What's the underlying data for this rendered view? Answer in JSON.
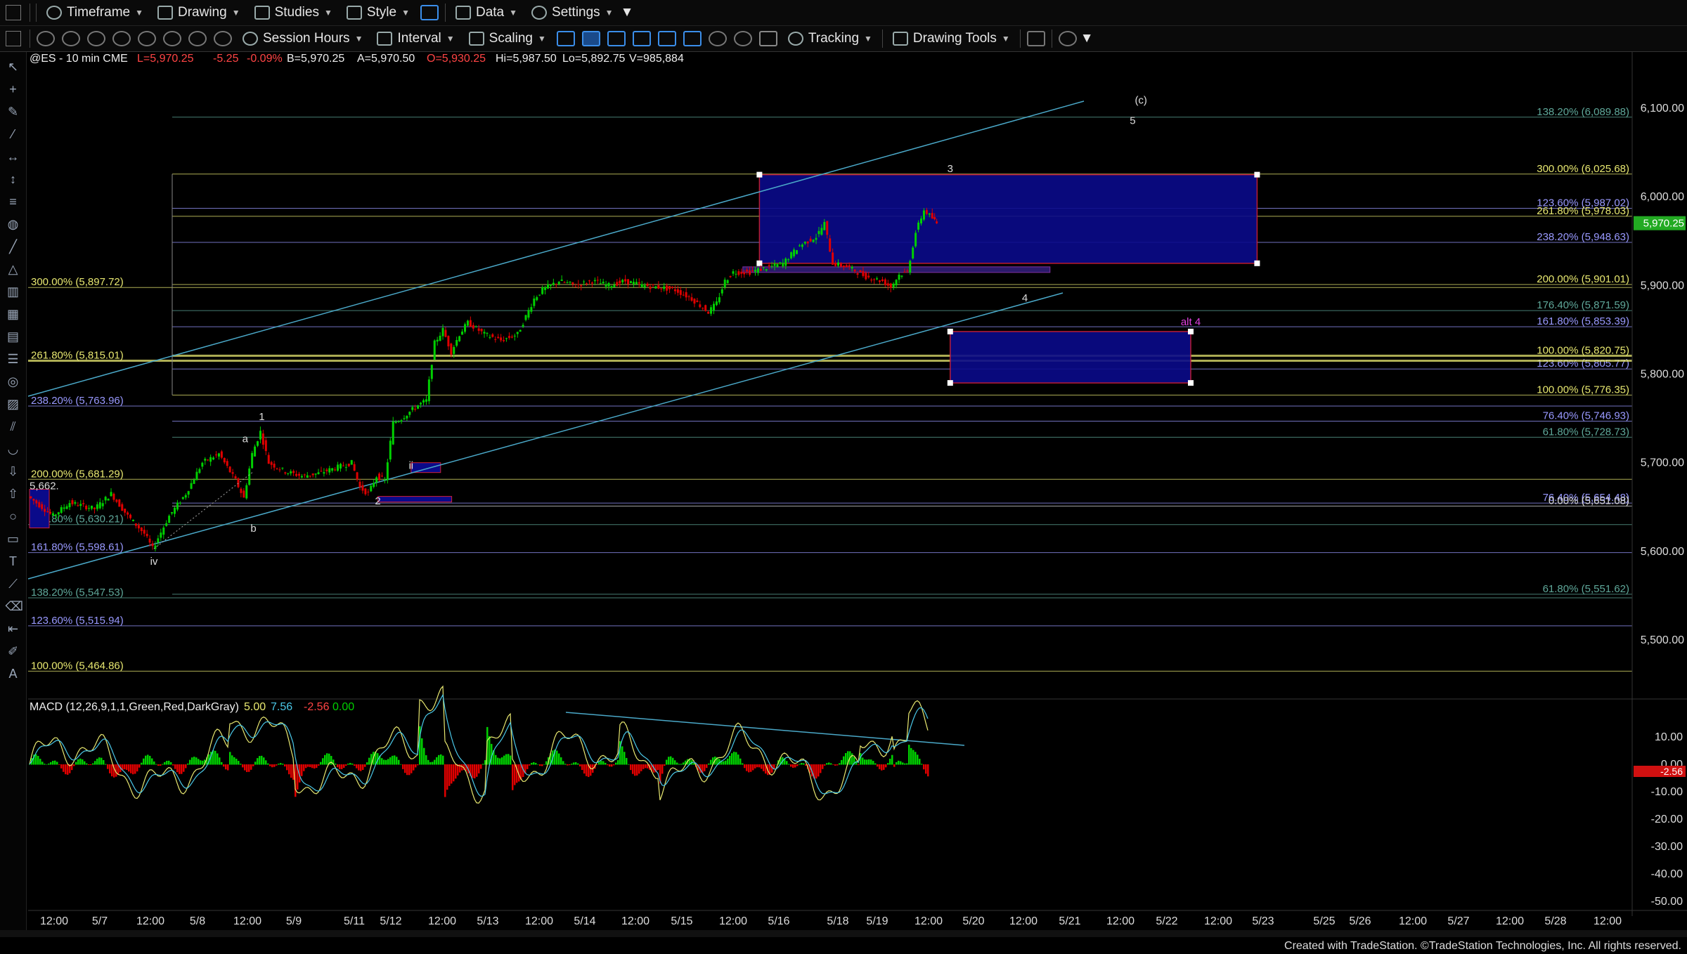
{
  "toolbar1": {
    "timeframe": "Timeframe",
    "drawing": "Drawing",
    "studies": "Studies",
    "style": "Style",
    "data": "Data",
    "settings": "Settings"
  },
  "toolbar2": {
    "session_hours": "Session Hours",
    "interval": "Interval",
    "scaling": "Scaling",
    "tracking": "Tracking",
    "drawing_tools": "Drawing Tools"
  },
  "header": {
    "symbol": "@ES - 10 min  CME",
    "last": "L=5,970.25",
    "change": "-5.25",
    "change_pct": "-0.09%",
    "bid": "B=5,970.25",
    "ask": "A=5,970.50",
    "open": "O=5,930.25",
    "high": "Hi=5,987.50",
    "low": "Lo=5,892.75",
    "volume": "V=985,884"
  },
  "colors": {
    "up": "#00d000",
    "down": "#e00000",
    "yellow_fib": "#e8e870",
    "blue_fib": "#9999ff",
    "teal_fib": "#5fa89a",
    "box_fill": "#0a0a8a",
    "box_border": "#d0203a",
    "trend_line": "#4aa8c8",
    "price_badge": "#22aa22"
  },
  "chart_data": {
    "type": "line",
    "title": "@ES - 10 min  CME",
    "ylim": [
      5420,
      6140
    ],
    "y_ticks": [
      5500,
      5600,
      5700,
      5800,
      5900,
      6000,
      6100
    ],
    "y_tick_labels": [
      "5,500.00",
      "5,600.00",
      "5,700.00",
      "5,800.00",
      "5,900.00",
      "6,000.00",
      "6,100.00"
    ],
    "x_tick_labels": [
      "12:00",
      "5/7",
      "12:00",
      "5/8",
      "12:00",
      "5/9",
      "5/11",
      "5/12",
      "12:00",
      "5/13",
      "12:00",
      "5/14",
      "12:00",
      "5/15",
      "12:00",
      "5/16",
      "5/18",
      "5/19",
      "12:00",
      "5/20",
      "12:00",
      "5/21",
      "12:00",
      "5/22",
      "12:00",
      "5/23",
      "5/25",
      "5/26",
      "12:00",
      "5/27",
      "12:00",
      "5/28",
      "12:00"
    ],
    "current_price": "5,970.25",
    "price_path": [
      [
        0,
        5662
      ],
      [
        3,
        5640
      ],
      [
        5,
        5655
      ],
      [
        8,
        5648
      ],
      [
        10,
        5665
      ],
      [
        12,
        5640
      ],
      [
        14,
        5620
      ],
      [
        15,
        5603
      ],
      [
        17,
        5640
      ],
      [
        19,
        5665
      ],
      [
        21,
        5700
      ],
      [
        23,
        5710
      ],
      [
        25,
        5680
      ],
      [
        26,
        5660
      ],
      [
        27,
        5710
      ],
      [
        28,
        5735
      ],
      [
        29,
        5700
      ],
      [
        31,
        5690
      ],
      [
        33,
        5685
      ],
      [
        35,
        5688
      ],
      [
        37,
        5694
      ],
      [
        39,
        5700
      ],
      [
        40,
        5672
      ],
      [
        41,
        5665
      ],
      [
        42,
        5685
      ],
      [
        43,
        5680
      ],
      [
        44,
        5745
      ],
      [
        45,
        5750
      ],
      [
        47,
        5765
      ],
      [
        48,
        5770
      ],
      [
        49,
        5835
      ],
      [
        50,
        5850
      ],
      [
        51,
        5825
      ],
      [
        52,
        5845
      ],
      [
        53,
        5858
      ],
      [
        55,
        5845
      ],
      [
        57,
        5838
      ],
      [
        59,
        5845
      ],
      [
        61,
        5885
      ],
      [
        62,
        5895
      ],
      [
        64,
        5905
      ],
      [
        66,
        5900
      ],
      [
        68,
        5905
      ],
      [
        70,
        5900
      ],
      [
        72,
        5905
      ],
      [
        74,
        5900
      ],
      [
        76,
        5898
      ],
      [
        78,
        5895
      ],
      [
        80,
        5885
      ],
      [
        82,
        5870
      ],
      [
        83,
        5880
      ],
      [
        84,
        5905
      ],
      [
        85,
        5915
      ],
      [
        87,
        5915
      ],
      [
        89,
        5920
      ],
      [
        91,
        5925
      ],
      [
        93,
        5945
      ],
      [
        95,
        5955
      ],
      [
        96,
        5970
      ],
      [
        97,
        5925
      ],
      [
        99,
        5920
      ],
      [
        101,
        5910
      ],
      [
        103,
        5905
      ],
      [
        104,
        5898
      ],
      [
        105,
        5912
      ],
      [
        106,
        5915
      ],
      [
        107,
        5960
      ],
      [
        108,
        5985
      ],
      [
        109,
        5976
      ],
      [
        109.5,
        5970
      ]
    ],
    "fib_levels": [
      {
        "label": "138.20% (6,089.88)",
        "value": 6089.88,
        "color": "teal",
        "side": "right"
      },
      {
        "label": "300.00% (6,025.68)",
        "value": 6025.68,
        "color": "yellow",
        "side": "right"
      },
      {
        "label": "123.60% (5,987.02)",
        "value": 5987.02,
        "color": "blue",
        "side": "right"
      },
      {
        "label": "261.80% (5,978.03)",
        "value": 5978.03,
        "color": "yellow",
        "side": "right"
      },
      {
        "label": "238.20% (5,948.63)",
        "value": 5948.63,
        "color": "blue",
        "side": "right"
      },
      {
        "label": "200.00% (5,901.01)",
        "value": 5901.01,
        "color": "yellow",
        "side": "right"
      },
      {
        "label": "176.40% (5,871.59)",
        "value": 5871.59,
        "color": "teal",
        "side": "right"
      },
      {
        "label": "161.80% (5,853.39)",
        "value": 5853.39,
        "color": "blue",
        "side": "right"
      },
      {
        "label": "100.00% (5,820.75)",
        "value": 5820.75,
        "color": "yellow",
        "side": "right"
      },
      {
        "label": "123.60% (5,805.77)",
        "value": 5805.77,
        "color": "blue",
        "side": "right"
      },
      {
        "label": "100.00% (5,776.35)",
        "value": 5776.35,
        "color": "yellow",
        "side": "right"
      },
      {
        "label": "76.40% (5,746.93)",
        "value": 5746.93,
        "color": "blue",
        "side": "right"
      },
      {
        "label": "61.80% (5,728.73)",
        "value": 5728.73,
        "color": "teal",
        "side": "right"
      },
      {
        "label": "76.40% (5,654.48)",
        "value": 5654.48,
        "color": "blue",
        "side": "right"
      },
      {
        "label": "0.00% (5,651.08)",
        "value": 5651.08,
        "color": "white",
        "side": "right"
      },
      {
        "label": "61.80% (5,551.62)",
        "value": 5551.62,
        "color": "teal",
        "side": "right"
      },
      {
        "label": "300.00% (5,897.72)",
        "value": 5897.72,
        "color": "yellow",
        "side": "left"
      },
      {
        "label": "261.80% (5,815.01)",
        "value": 5815.01,
        "color": "yellow",
        "side": "left"
      },
      {
        "label": "238.20% (5,763.96)",
        "value": 5763.96,
        "color": "blue",
        "side": "left"
      },
      {
        "label": "200.00% (5,681.29)",
        "value": 5681.29,
        "color": "yellow",
        "side": "left"
      },
      {
        "label": "161.80% (5,630.21)",
        "value": 5630.21,
        "color": "teal",
        "side": "left"
      },
      {
        "label": "161.80% (5,598.61)",
        "value": 5598.61,
        "color": "blue",
        "side": "left"
      },
      {
        "label": "138.20% (5,547.53)",
        "value": 5547.53,
        "color": "teal",
        "side": "left"
      },
      {
        "label": "123.60% (5,515.94)",
        "value": 5515.94,
        "color": "blue",
        "side": "left"
      },
      {
        "label": "100.00% (5,464.86)",
        "value": 5464.86,
        "color": "yellow",
        "side": "left"
      }
    ],
    "zones": [
      {
        "name": "upper-target-box",
        "x1": 88,
        "x2": 148,
        "y1": 5925,
        "y2": 6025
      },
      {
        "name": "alt4-box",
        "x1": 111,
        "x2": 140,
        "y1": 5790,
        "y2": 5848
      }
    ],
    "wave_labels": [
      {
        "text": "1",
        "x": 28,
        "y": 5748
      },
      {
        "text": "a",
        "x": 26,
        "y": 5723
      },
      {
        "text": "b",
        "x": 27,
        "y": 5622
      },
      {
        "text": "2",
        "x": 42,
        "y": 5653
      },
      {
        "text": "iv",
        "x": 15,
        "y": 5585
      },
      {
        "text": "3",
        "x": 111,
        "y": 6028
      },
      {
        "text": "4",
        "x": 120,
        "y": 5882
      },
      {
        "text": "alt 4",
        "x": 140,
        "y": 5855
      },
      {
        "text": "(c)",
        "x": 134,
        "y": 6105
      },
      {
        "text": "5",
        "x": 133,
        "y": 6082
      },
      {
        "text": "ii",
        "x": 46,
        "y": 5693
      }
    ],
    "price_annotations": [
      {
        "text": "5,662.",
        "x": 0,
        "y": 5670
      }
    ],
    "macd": {
      "label": "MACD (12,26,9,1,1,Green,Red,DarkGray)",
      "values": [
        "5.00",
        "7.56",
        "-2.56",
        "0.00"
      ],
      "ylim": [
        -55,
        20
      ],
      "y_ticks": [
        10,
        0,
        -10,
        -20,
        -30,
        -40,
        -50
      ],
      "y_tick_labels": [
        "10.00",
        "0.00",
        "-10.00",
        "-20.00",
        "-30.00",
        "-40.00",
        "-50.00"
      ],
      "current_label": "-2.56"
    }
  },
  "footer": "Created with TradeStation. ©TradeStation Technologies, Inc. All rights reserved."
}
